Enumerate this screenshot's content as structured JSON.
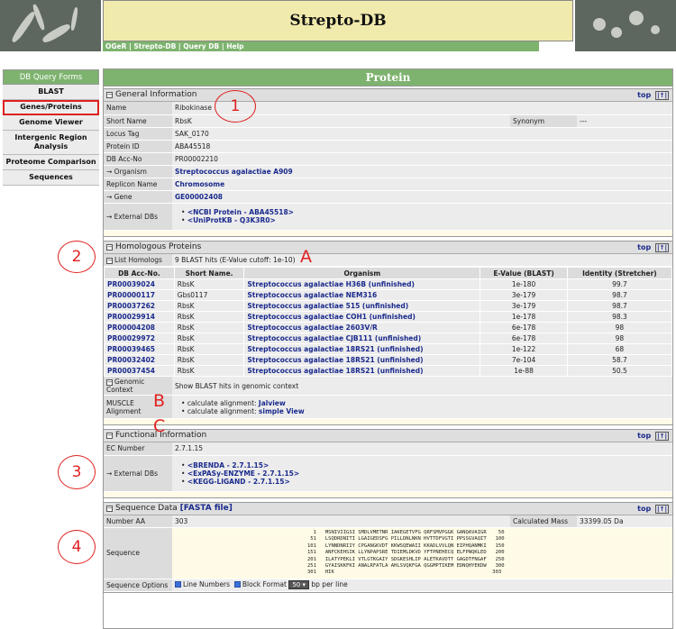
{
  "header": {
    "title": "Strepto-DB",
    "nav": [
      "OGeR",
      "Strepto-DB",
      "Query DB",
      "Help"
    ],
    "nav_sep": " | "
  },
  "sidebar": {
    "heading": "DB Query Forms",
    "items": [
      "BLAST",
      "Genes/Proteins",
      "Genome Viewer",
      "Intergenic Region Analysis",
      "Proteome Comparison",
      "Sequences"
    ]
  },
  "main": {
    "title": "Protein"
  },
  "common": {
    "top_label": "top",
    "top_icon": "|↑|",
    "collapse_icon": "−"
  },
  "general": {
    "heading": "General Information",
    "name_label": "Name",
    "name": "Ribokinase",
    "short_label": "Short Name",
    "short": "RbsK",
    "synonym_label": "Synonym",
    "synonym": "---",
    "locus_label": "Locus Tag",
    "locus": "SAK_0170",
    "protein_label": "Protein ID",
    "protein": "ABA45518",
    "acc_label": "DB Acc-No",
    "acc": "PR00002210",
    "org_label": "→ Organism",
    "org": "Streptococcus agalactiae A909",
    "rep_label": "Replicon Name",
    "rep": "Chromosome",
    "gene_label": "→ Gene",
    "gene": "GE00002408",
    "ext_label": "→ External DBs",
    "ext": [
      "<NCBI Protein - ABA45518>",
      "<UniProtKB - Q3K3R0>"
    ]
  },
  "homologs": {
    "heading": "Homologous Proteins",
    "list_label": "List Homologs",
    "list_value": "9 BLAST hits (E-Value cutoff: 1e-10)",
    "columns": [
      "DB Acc-No.",
      "Short Name.",
      "Organism",
      "E-Value (BLAST)",
      "Identity (Stretcher)"
    ],
    "rows": [
      [
        "PR00039024",
        "RbsK",
        "Streptococcus agalactiae H36B (unfinished)",
        "1e-180",
        "99.7"
      ],
      [
        "PR00000117",
        "Gbs0117",
        "Streptococcus agalactiae NEM316",
        "3e-179",
        "98.7"
      ],
      [
        "PR00037262",
        "RbsK",
        "Streptococcus agalactiae 515 (unfinished)",
        "3e-179",
        "98.7"
      ],
      [
        "PR00029914",
        "RbsK",
        "Streptococcus agalactiae COH1 (unfinished)",
        "1e-178",
        "98.3"
      ],
      [
        "PR00004208",
        "RbsK",
        "Streptococcus agalactiae 2603V/R",
        "6e-178",
        "98"
      ],
      [
        "PR00029972",
        "RbsK",
        "Streptococcus agalactiae CJB111 (unfinished)",
        "6e-178",
        "98"
      ],
      [
        "PR00039465",
        "RbsK",
        "Streptococcus agalactiae 18RS21 (unfinished)",
        "1e-122",
        "68"
      ],
      [
        "PR00032402",
        "RbsK",
        "Streptococcus agalactiae 18RS21 (unfinished)",
        "7e-104",
        "58.7"
      ],
      [
        "PR00037454",
        "RbsK",
        "Streptococcus agalactiae 18RS21 (unfinished)",
        "1e-88",
        "50.5"
      ]
    ],
    "genomic_label": "Genomic Context",
    "genomic_value": "Show BLAST hits in genomic context",
    "muscle_label": "MUSCLE Alignment",
    "align_prefix": "calculate alignment: ",
    "align_links": [
      "Jalview",
      "simple View"
    ]
  },
  "functional": {
    "heading": "Functional Information",
    "ec_label": "EC Number",
    "ec": "2.7.1.15",
    "ext_label": "→ External DBs",
    "ext": [
      "<BRENDA - 2.7.1.15>",
      "<ExPASy-ENZYME - 2.7.1.15>",
      "<KEGG-LIGAND - 2.7.1.15>"
    ]
  },
  "sequence": {
    "heading": "Sequence Data",
    "fasta_link": "[FASTA file]",
    "aa_label": "Number AA",
    "aa": "303",
    "mass_label": "Calculated Mass",
    "mass": "33399.05 Da",
    "seq_label": "Sequence",
    "lines": [
      "  1   MSNIVIIGSI SMDLVMETNR IAKEGETVFG QRFSMVPGGK GANQAVAIGR    50",
      " 51   LSQDRDNITI LGAIGEDSFG PILLDNLNKN HVTTDFVGTI PPSSGVAQIT   100",
      "101   LYNNDNRIIY CPGANGKVDT KKWSQEWAII KKADLVVLQN EIPHQANMKI   150",
      "151   ANFCKEHSIK LLYNPAPSRE TDIEMLDKVD YFTPNEHECQ ELFPNQKLED   200",
      "201   ILATYPEKLI VTLGTKGAIY SDGKESHLIP ALETKAVDTT GAGDTFNGAF   250",
      "251   GYAISKKFKI ANALRFATLA AHLSVQKFGA QGGMPTIKEM EDNQHYEKDW   300",
      "301   HIK                                                     303"
    ],
    "opt_label": "Sequence Options",
    "opt_line": "Line Numbers",
    "opt_block": "Block Format",
    "opt_bp": "50",
    "opt_suffix": "bp per line"
  },
  "annotations": {
    "m1": "1",
    "m2": "2",
    "m3": "3",
    "m4": "4",
    "a": "A",
    "b": "B",
    "c": "C"
  }
}
